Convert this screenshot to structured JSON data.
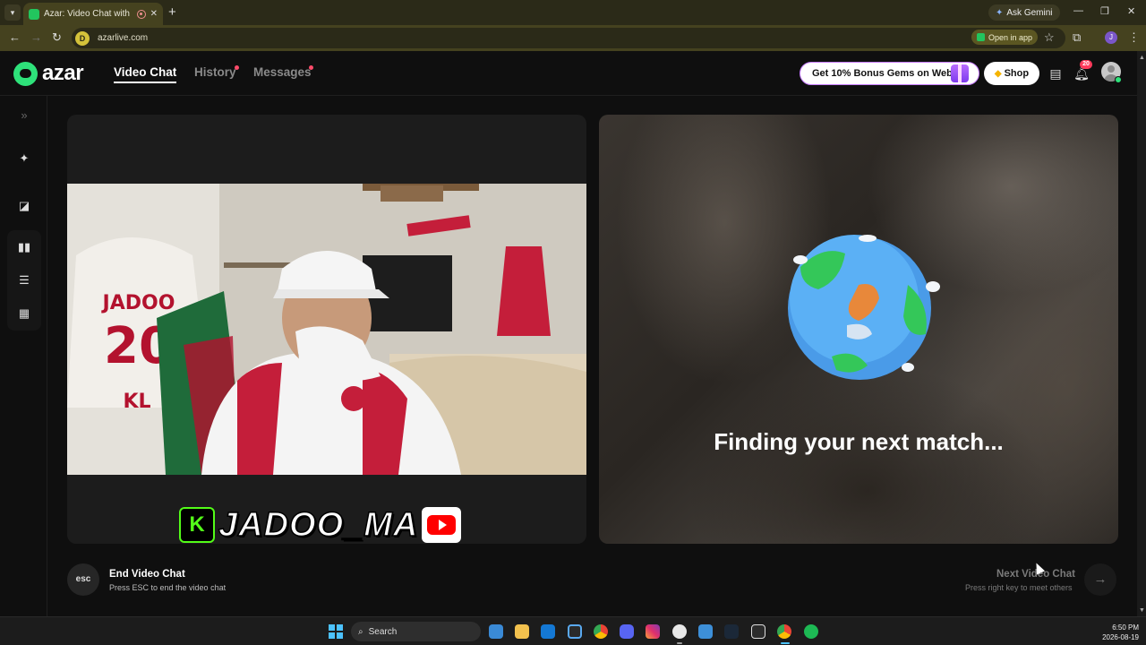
{
  "browser": {
    "tab_title": "Azar: Video Chat with New",
    "url": "azarlive.com",
    "site_badge": "D",
    "ask_gemini": "Ask Gemini",
    "open_in_app": "Open in app",
    "profile_initial": "J"
  },
  "header": {
    "logo": "azar",
    "nav": [
      {
        "label": "Video Chat",
        "active": true
      },
      {
        "label": "History",
        "active": false,
        "has_dot": true
      },
      {
        "label": "Messages",
        "active": false,
        "has_dot": true
      }
    ],
    "bonus_label": "Get 10% Bonus Gems on Web!",
    "shop_label": "Shop",
    "notification_count": "20"
  },
  "sidebar": {
    "icons": [
      "expand-icon",
      "magic-wand-icon",
      "filter-icon",
      "layout-split-vertical-icon",
      "layout-split-horizontal-icon",
      "layout-grid-icon"
    ]
  },
  "left_panel": {
    "streamer_handle": "JADOO_MA",
    "kick_glyph": "K",
    "jersey_name": "JADOO",
    "jersey_number": "20",
    "jersey_extra": "KL"
  },
  "right_panel": {
    "status_text": "Finding your next match..."
  },
  "controls": {
    "esc_label": "esc",
    "end_title": "End Video Chat",
    "end_subtitle": "Press ESC to end the video chat",
    "next_title": "Next Video Chat",
    "next_subtitle": "Press right key to meet others"
  },
  "taskbar": {
    "search_placeholder": "Search",
    "time": "6:50 PM",
    "date": "2026-08-19",
    "apps": [
      "widgets-icon",
      "file-explorer-icon",
      "outlook-icon",
      "store-icon",
      "chrome-icon",
      "discord-icon",
      "instagram-icon",
      "messenger-icon",
      "app-icon",
      "steam-icon",
      "app-icon-2",
      "chrome-active-icon",
      "spotify-icon"
    ]
  },
  "colors": {
    "brand_green": "#2ee27a",
    "chrome_bg": "#45421f",
    "page_bg": "#0f0f0f",
    "notification_red": "#ff3b5c"
  }
}
